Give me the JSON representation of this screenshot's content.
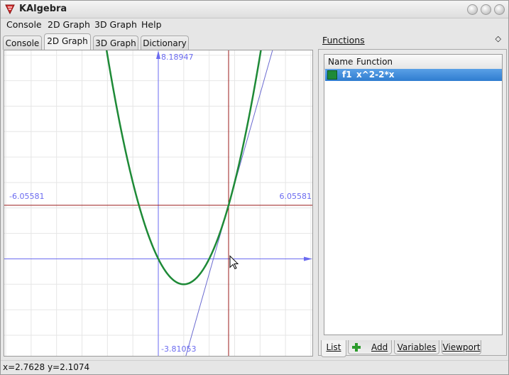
{
  "app": {
    "title": "KAlgebra"
  },
  "menu": {
    "items": [
      "Console",
      "2D Graph",
      "3D Graph",
      "Help"
    ]
  },
  "tabs": [
    "Console",
    "2D Graph",
    "3D Graph",
    "Dictionary"
  ],
  "active_tab": "2D Graph",
  "graph": {
    "x_min_label": "-6.05581",
    "x_max_label": "6.05581",
    "y_max_label": "8.18947",
    "y_min_label": "-3.81053",
    "view": {
      "x_min": -6.05581,
      "x_max": 6.05581,
      "y_min": -3.81053,
      "y_max": 8.18947
    },
    "curve_color": "#1e8a37",
    "tangent_color": "#6a6ad0",
    "axis_color": "#6b6bf0",
    "crosshair_color": "#9b1b1b",
    "crosshair": {
      "x": 2.7628,
      "y": 2.1074
    }
  },
  "functions_panel": {
    "title": "Functions",
    "close_glyph": "◇",
    "columns": [
      "Name",
      "Function"
    ],
    "rows": [
      {
        "name": "f1",
        "expression": "x^2-2*x",
        "color": "#1e8a37"
      }
    ]
  },
  "bottom_tabs": [
    "List",
    "Add",
    "Variables",
    "Viewport"
  ],
  "active_bottom_tab": "List",
  "status": {
    "text": "x=2.7628 y=2.1074"
  }
}
